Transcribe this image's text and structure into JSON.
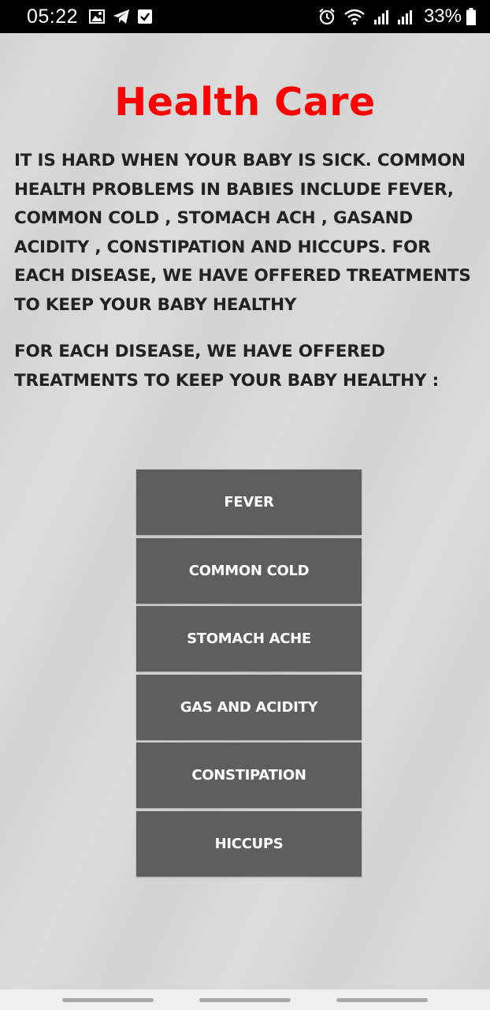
{
  "status_bar": {
    "time": "05:22",
    "battery_percent": "33%",
    "left_icons": [
      "image-icon",
      "telegram-icon",
      "checkbox-icon"
    ],
    "right_icons": [
      "alarm-icon",
      "wifi-icon",
      "signal-icon",
      "signal-icon",
      "battery-icon"
    ]
  },
  "page": {
    "title": "Health Care",
    "title_color": "#ff0000",
    "intro": "IT IS HARD WHEN YOUR BABY IS SICK. COMMON HEALTH PROBLEMS IN BABIES INCLUDE  FEVER, COMMON COLD , STOMACH ACH , GASAND ACIDITY , CONSTIPATION AND HICCUPS. FOR EACH DISEASE, WE HAVE OFFERED TREATMENTS TO KEEP YOUR BABY HEALTHY",
    "subtitle": "FOR EACH DISEASE, WE HAVE OFFERED TREATMENTS TO KEEP YOUR BABY HEALTHY :"
  },
  "menu": {
    "items": [
      {
        "label": "FEVER"
      },
      {
        "label": "COMMON COLD"
      },
      {
        "label": "STOMACH ACHE"
      },
      {
        "label": "GAS AND ACIDITY"
      },
      {
        "label": "CONSTIPATION"
      },
      {
        "label": "HICCUPS"
      }
    ],
    "button_color": "#5e5e5e"
  }
}
